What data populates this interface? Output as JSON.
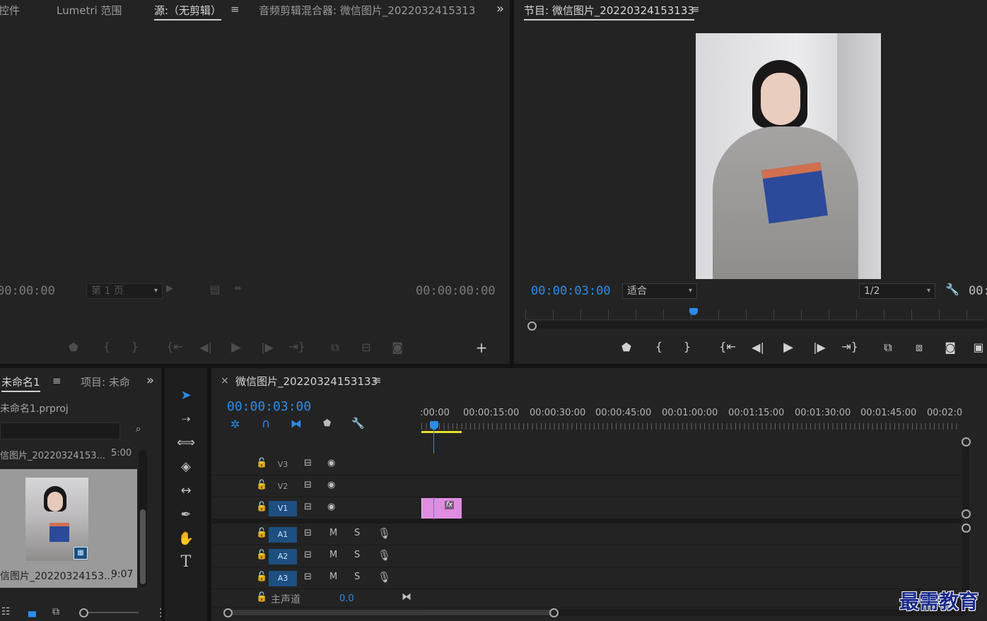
{
  "source_panel": {
    "tabs": [
      "控件",
      "Lumetri 范围",
      "源:（无剪辑）",
      "音频剪辑混合器: 微信图片_2022032415313"
    ],
    "timecode_left": "00:00:00",
    "page_dropdown": "第 1 页",
    "timecode_right": "00:00:00:00"
  },
  "program_panel": {
    "title": "节目: 微信图片_20220324153133",
    "timecode": "00:00:03:00",
    "fit_dropdown": "适合",
    "resolution_dropdown": "1/2",
    "timecode_right_partial": "00:"
  },
  "project_panel": {
    "tab_active": "未命名1",
    "tab_other": "项目: 未命",
    "project_file": "未命名1.prproj",
    "list_item_name": "信图片_20220324153...",
    "list_item_duration": "5:00",
    "thumb_name": "信图片_20220324153...",
    "thumb_duration": "9:07"
  },
  "timeline": {
    "tab_title": "微信图片_20220324153133",
    "timecode": "00:00:03:00",
    "ruler": [
      ":00:00",
      "00:00:15:00",
      "00:00:30:00",
      "00:00:45:00",
      "00:01:00:00",
      "00:01:15:00",
      "00:01:30:00",
      "00:01:45:00",
      "00:02:0"
    ],
    "video_tracks": [
      "V3",
      "V2",
      "V1"
    ],
    "audio_tracks": [
      "A1",
      "A2",
      "A3"
    ],
    "mute_label": "M",
    "solo_label": "S",
    "master_label": "主声道",
    "master_value": "0.0",
    "fx_badge": "fx"
  },
  "watermark": "最需教育",
  "colors": {
    "accent_blue": "#2d8ceb",
    "clip_pink": "#e08ce0",
    "track_target": "#1d4f80"
  }
}
